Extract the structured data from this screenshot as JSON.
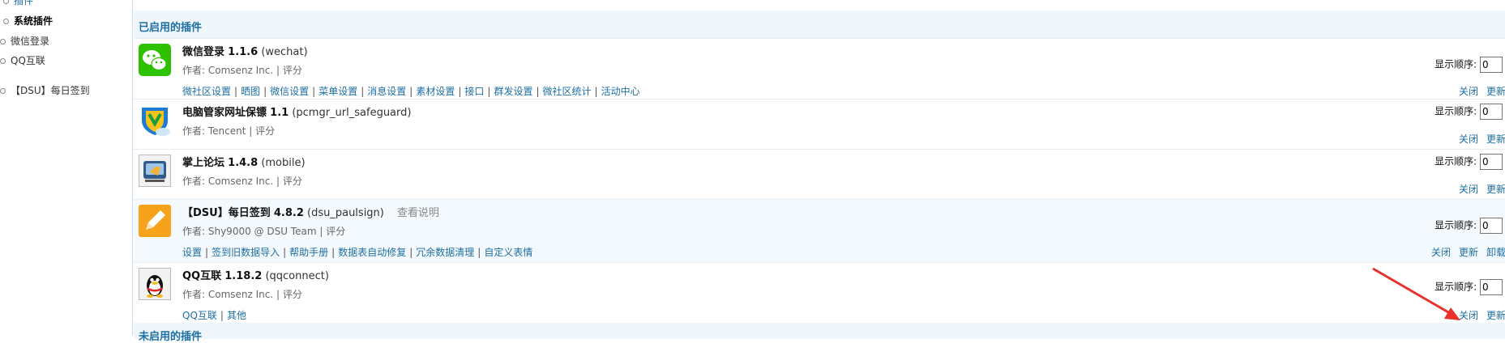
{
  "sidebar": {
    "items": [
      {
        "label": "插件"
      },
      {
        "label": "系统插件"
      },
      {
        "label": "微信登录"
      },
      {
        "label": "QQ互联"
      },
      {
        "label": "【DSU】每日签到"
      }
    ]
  },
  "section": {
    "enabled_title": "已启用的插件",
    "disabled_title": "未启用的插件"
  },
  "order_label": "显示顺序:",
  "plugins": [
    {
      "name": "微信登录",
      "version": "1.1.6",
      "ident": "(wechat)",
      "author": "作者: Comsenz Inc. | 评分",
      "order": "0",
      "links": [
        "微社区设置",
        "晒图",
        "微信设置",
        "菜单设置",
        "消息设置",
        "素材设置",
        "接口",
        "群发设置",
        "微社区统计",
        "活动中心"
      ],
      "ops": [
        "关闭",
        "更新"
      ]
    },
    {
      "name": "电脑管家网址保镖",
      "version": "1.1",
      "ident": "(pcmgr_url_safeguard)",
      "author": "作者: Tencent | 评分",
      "order": "0",
      "links": [],
      "ops": [
        "关闭",
        "更新"
      ]
    },
    {
      "name": "掌上论坛",
      "version": "1.4.8",
      "ident": "(mobile)",
      "author": "作者: Comsenz Inc. | 评分",
      "order": "0",
      "links": [],
      "ops": [
        "关闭",
        "更新"
      ]
    },
    {
      "name": "【DSU】每日签到",
      "version": "4.8.2",
      "ident": "(dsu_paulsign)",
      "info": "查看说明",
      "author": "作者: Shy9000 @ DSU Team | 评分",
      "order": "0",
      "links": [
        "设置",
        "签到旧数据导入",
        "帮助手册",
        "数据表自动修复",
        "冗余数据清理",
        "自定义表情"
      ],
      "ops": [
        "关闭",
        "更新",
        "卸载"
      ]
    },
    {
      "name": "QQ互联",
      "version": "1.18.2",
      "ident": "(qqconnect)",
      "author": "作者: Comsenz Inc. | 评分",
      "order": "0",
      "links": [
        "QQ互联",
        "其他"
      ],
      "ops": [
        "关闭",
        "更新"
      ]
    }
  ],
  "colors": {
    "link": "#1d6fa3",
    "header_bg": "#eef6fb",
    "arrow": "#e8322b"
  }
}
